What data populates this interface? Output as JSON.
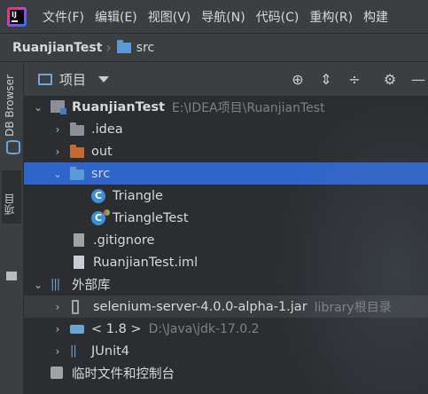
{
  "menubar": {
    "items": [
      "文件(F)",
      "编辑(E)",
      "视图(V)",
      "导航(N)",
      "代码(C)",
      "重构(R)",
      "构建"
    ]
  },
  "breadcrumb": {
    "project": "RuanjianTest",
    "folder": "src"
  },
  "left_strip": {
    "db_browser": "DB Browser",
    "project_tab": "项目"
  },
  "toolbar": {
    "view_label": "项目",
    "icons": [
      "locate-icon",
      "expand-all-icon",
      "collapse-all-icon",
      "settings-icon",
      "hide-icon"
    ]
  },
  "tree": {
    "root": {
      "name": "RuanjianTest",
      "path": "E:\\IDEA项目\\RuanjianTest"
    },
    "idea": ".idea",
    "out": "out",
    "src": "src",
    "triangle": "Triangle",
    "triangle_test": "TriangleTest",
    "gitignore": ".gitignore",
    "iml": "RuanjianTest.iml",
    "external_libs": "外部库",
    "selenium": {
      "name": "selenium-server-4.0.0-alpha-1.jar",
      "note": "library根目录"
    },
    "jdk": {
      "name": "< 1.8 >",
      "path": "D:\\Java\\jdk-17.0.2"
    },
    "junit": "JUnit4",
    "scratches": "临时文件和控制台"
  },
  "colors": {
    "selection": "#2f65ca",
    "background": "#2b2d30",
    "panel": "#3c3f41"
  }
}
